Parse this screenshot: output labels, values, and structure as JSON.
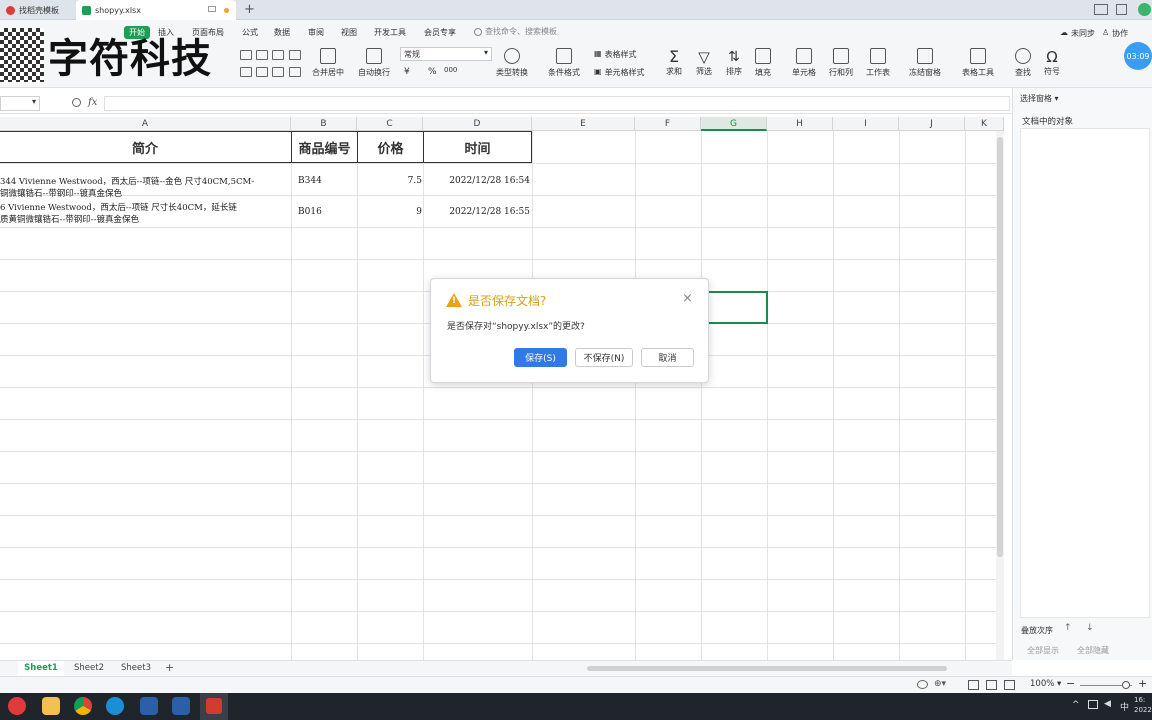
{
  "tabs": {
    "template_tab": "找稻壳模板",
    "file_tab": "shopyy.xlsx",
    "new_tab_icon": "plus-icon"
  },
  "menus": [
    "开始",
    "插入",
    "页面布局",
    "公式",
    "数据",
    "审阅",
    "视图",
    "开发工具",
    "会员专享"
  ],
  "search": {
    "placeholder": "查找命令、搜索模板"
  },
  "top_right": {
    "sync": "未同步",
    "collab": "协作",
    "timer": "03:09"
  },
  "watermark": "字符科技",
  "ribbon": {
    "merge": "合并居中",
    "wrap": "自动换行",
    "number_format": "常规",
    "currency": "¥",
    "percent": "%",
    "thousands": "000",
    "type_convert": "类型转换",
    "table_style": "表格样式",
    "cond_format": "条件格式",
    "cell_style": "单元格样式",
    "sum": "求和",
    "filter": "筛选",
    "sort": "排序",
    "fill": "填充",
    "cell": "单元格",
    "rowcol": "行和列",
    "sheet": "工作表",
    "freeze": "冻结窗格",
    "table_tools": "表格工具",
    "find": "查找",
    "symbol": "符号"
  },
  "formula_bar": {
    "fx": "fx",
    "value": ""
  },
  "columns": [
    "A",
    "B",
    "C",
    "D",
    "E",
    "F",
    "G",
    "H",
    "I",
    "J",
    "K"
  ],
  "selected_column": "G",
  "table": {
    "headers": [
      "简介",
      "商品编号",
      "价格",
      "时间"
    ],
    "rows": [
      {
        "intro_line1": "344 Vivienne Westwood，西太后--项链--金色  尺寸40CM,5CM-",
        "intro_line2": "铜微镶锆石--带钢印--镀真金保色",
        "code": "B344",
        "price": "7.5",
        "time": "2022/12/28 16:54"
      },
      {
        "intro_line1": "6  Vivienne Westwood，西太后--项链  尺寸长40CM，延长链",
        "intro_line2": "质黄铜微镶锆石--带钢印--镀真金保色",
        "code": "B016",
        "price": "9",
        "time": "2022/12/28 16:55"
      }
    ]
  },
  "right_pane": {
    "title": "选择窗格",
    "objects_label": "文档中的对象",
    "order_label": "叠放次序",
    "show_all": "全部显示",
    "hide_all": "全部隐藏"
  },
  "sheets": [
    "Sheet1",
    "Sheet2",
    "Sheet3"
  ],
  "active_sheet": "Sheet1",
  "status": {
    "zoom": "100%",
    "clock_time": "16:",
    "clock_date": "2022"
  },
  "dialog": {
    "title": "是否保存文档?",
    "message": "是否保存对“shopyy.xlsx”的更改?",
    "save": "保存(S)",
    "dont_save": "不保存(N)",
    "cancel": "取消"
  },
  "colors": {
    "accent_green": "#1f9d55",
    "dialog_primary": "#2f7ae5",
    "warning": "#e8a317"
  }
}
